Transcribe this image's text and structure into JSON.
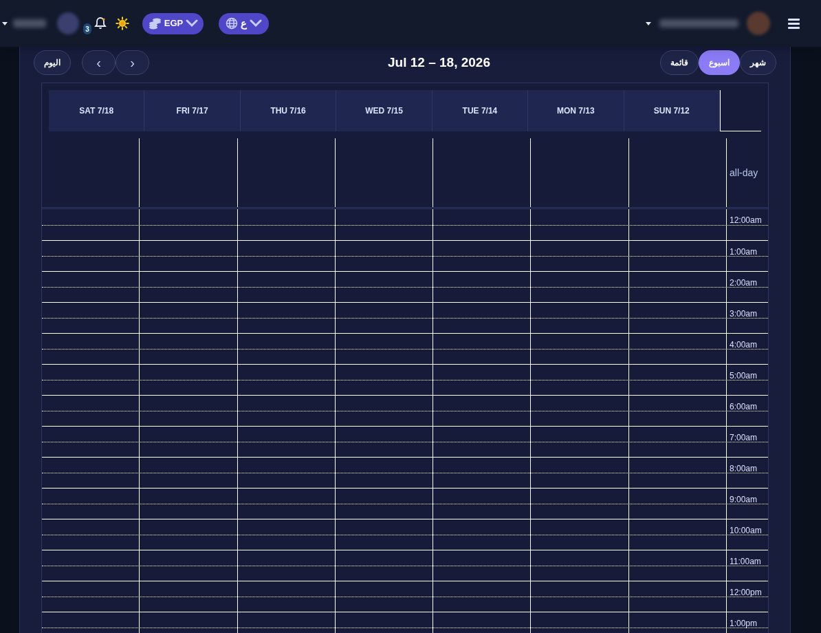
{
  "header": {
    "notifications": {
      "count": "3"
    },
    "currency": {
      "label": "EGP"
    },
    "language": {
      "label": "ع"
    }
  },
  "toolbar": {
    "today": "اليوم",
    "prev": "‹",
    "next": "›",
    "title": "Jul 12 – 18, 2026",
    "views": [
      {
        "label": "شهر",
        "selected": false
      },
      {
        "label": "اسبوع",
        "selected": true
      },
      {
        "label": "قائمة",
        "selected": false
      }
    ]
  },
  "calendar": {
    "days": [
      "SAT 7/18",
      "FRI 7/17",
      "THU 7/16",
      "WED 7/15",
      "TUE 7/14",
      "MON 7/13",
      "SUN 7/12"
    ],
    "all_day": "all-day",
    "times": [
      "12:00am",
      "1:00am",
      "2:00am",
      "3:00am",
      "4:00am",
      "5:00am",
      "6:00am",
      "7:00am",
      "8:00am",
      "9:00am",
      "10:00am",
      "11:00am",
      "12:00pm",
      "1:00pm"
    ]
  }
}
